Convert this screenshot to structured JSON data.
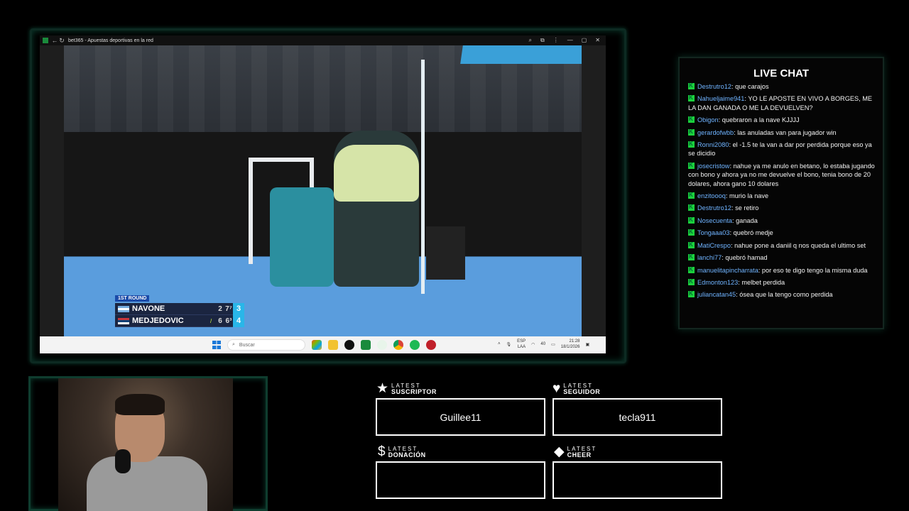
{
  "browser": {
    "title": "bet365 - Apuestas deportivas en la red"
  },
  "scoreboard": {
    "round": "1ST ROUND",
    "players": [
      {
        "name": "NAVONE",
        "set1": "2",
        "set2": "7⁷",
        "game": "3",
        "serving": false
      },
      {
        "name": "MEDJEDOVIC",
        "set1": "6",
        "set2": "6³",
        "game": "4",
        "serving": true
      }
    ]
  },
  "taskbar": {
    "search_placeholder": "Buscar",
    "lang": "ESP",
    "lang_sub": "LAA",
    "volume_label": "40",
    "time": "21:28",
    "date": "18/1/2026"
  },
  "chat": {
    "title": "LIVE CHAT",
    "messages": [
      {
        "user": "Destrutro12",
        "text": "que carajos"
      },
      {
        "user": "Nahueljaime941",
        "text": "YO LE APOSTE EN VIVO A BORGES, ME LA DAN GANADA O ME LA DEVUELVEN?"
      },
      {
        "user": "Obigon",
        "text": "quebraron a la nave KJJJJ"
      },
      {
        "user": "gerardofwbb",
        "text": "las anuladas van para jugador win"
      },
      {
        "user": "Ronni2080",
        "text": "el -1.5 te la van a dar por perdida porque eso ya se dicidio"
      },
      {
        "user": "josecristow",
        "text": "nahue ya me anulo en betano, lo estaba jugando con bono y ahora ya no me devuelve el bono, tenia bono de 20 dolares, ahora gano 10 dolares"
      },
      {
        "user": "enzitoooq",
        "text": "murio la nave"
      },
      {
        "user": "Destrutro12",
        "text": "se retiro"
      },
      {
        "user": "Nosecuenta",
        "text": "ganada"
      },
      {
        "user": "Tongaaa03",
        "text": "quebró medje"
      },
      {
        "user": "MatiCrespo",
        "text": "nahue pone a daniil q nos queda el ultimo set"
      },
      {
        "user": "lanchi77",
        "text": "quebró hamad"
      },
      {
        "user": "manuelitapincharrata",
        "text": "por eso te digo tengo la misma duda"
      },
      {
        "user": "Edmonton123",
        "text": "melbet perdida"
      },
      {
        "user": "juliancatan45",
        "text": "ósea que la tengo como perdida"
      }
    ]
  },
  "alerts": {
    "suscriptor": {
      "small": "LATEST",
      "label": "SUSCRIPTOR",
      "value": "Guillee11",
      "icon": "star-icon"
    },
    "seguidor": {
      "small": "LATEST",
      "label": "SEGUIDOR",
      "value": "tecla911",
      "icon": "heart-icon"
    },
    "donacion": {
      "small": "LATEST",
      "label": "DONACIÓN",
      "value": "",
      "icon": "dollar-icon"
    },
    "cheer": {
      "small": "LATEST",
      "label": "CHEER",
      "value": "",
      "icon": "diamond-icon"
    }
  },
  "colors": {
    "frame_glow": "#0b3d2e",
    "chat_user": "#6fb3ff",
    "badge": "#1bd13d",
    "scoreboard_bg": "#1b2540",
    "game_score": "#29b6e8"
  }
}
